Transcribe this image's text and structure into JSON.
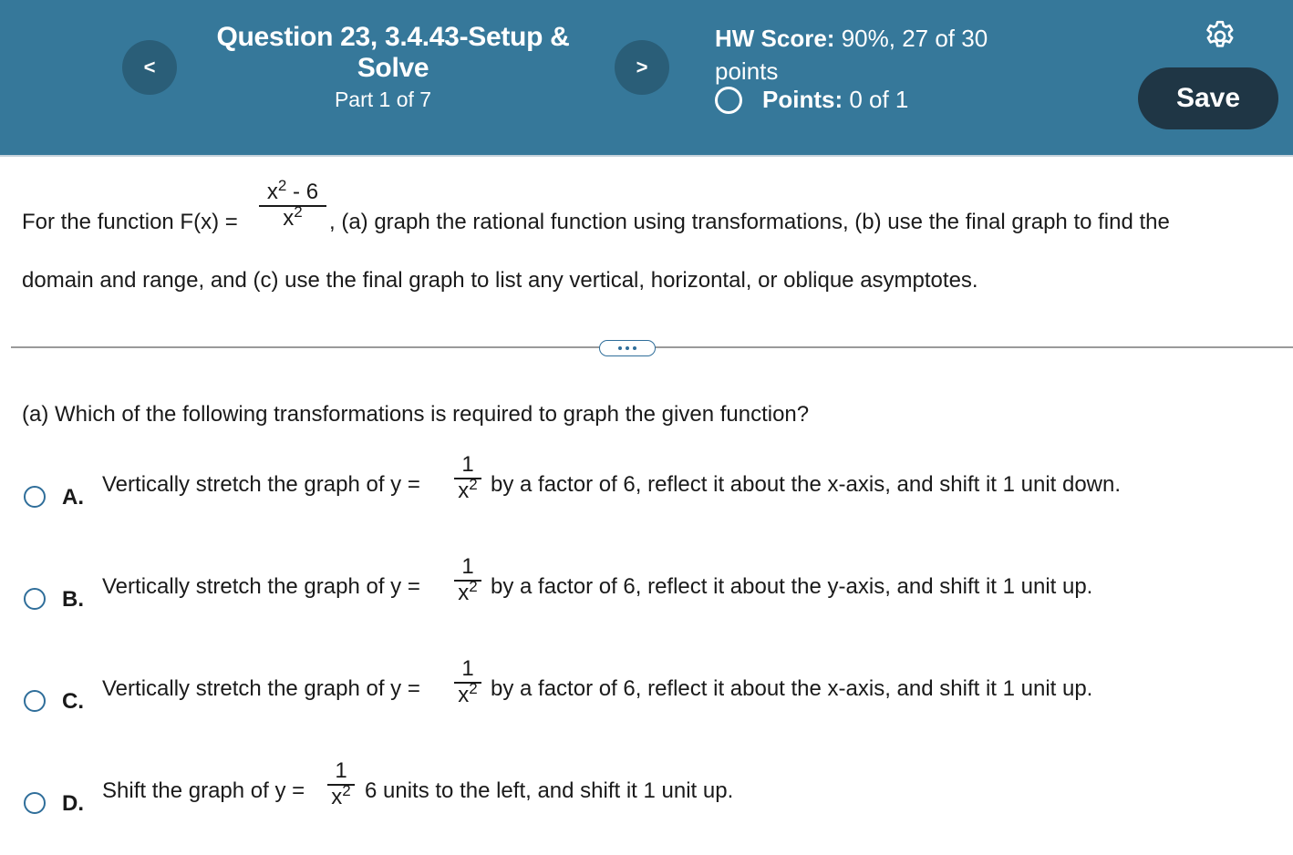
{
  "header": {
    "prev_label": "<",
    "next_label": ">",
    "question_title_line1": "Question 23, 3.4.43-Setup &",
    "question_title_line2": "Solve",
    "part": "Part 1 of 7",
    "hw_score_label": "HW Score:",
    "hw_score_value": "90%, 27 of 30",
    "hw_score_unit": "points",
    "points_label": "Points:",
    "points_value": "0 of 1",
    "save_label": "Save",
    "settings_icon": "gear-icon"
  },
  "problem": {
    "prefix": "For the function F(x) =",
    "frac_num": "x",
    "frac_num_exp": "2",
    "frac_num_rest": " - 6",
    "frac_den": "x",
    "frac_den_exp": "2",
    "suffix": ", (a) graph the rational function using transformations, (b) use the final graph to find the",
    "line2": "domain and range, and (c) use the final graph to list any vertical, horizontal, or oblique asymptotes."
  },
  "question": "(a) Which of the following transformations is required to graph the given function?",
  "fraction": {
    "num": "1",
    "den": "x",
    "den_exp": "2"
  },
  "options": [
    {
      "letter": "A.",
      "before": "Vertically stretch the graph of y =",
      "after": "by a factor of 6, reflect it about the x-axis, and shift it 1 unit down."
    },
    {
      "letter": "B.",
      "before": "Vertically stretch the graph of y =",
      "after": "by a factor of 6, reflect it about the y-axis, and shift it 1 unit up."
    },
    {
      "letter": "C.",
      "before": "Vertically stretch the graph of y =",
      "after": "by a factor of 6, reflect it about the x-axis, and shift it 1 unit up."
    },
    {
      "letter": "D.",
      "before": "Shift the graph of y =",
      "after": "6 units to the left, and shift it 1 unit up."
    }
  ]
}
